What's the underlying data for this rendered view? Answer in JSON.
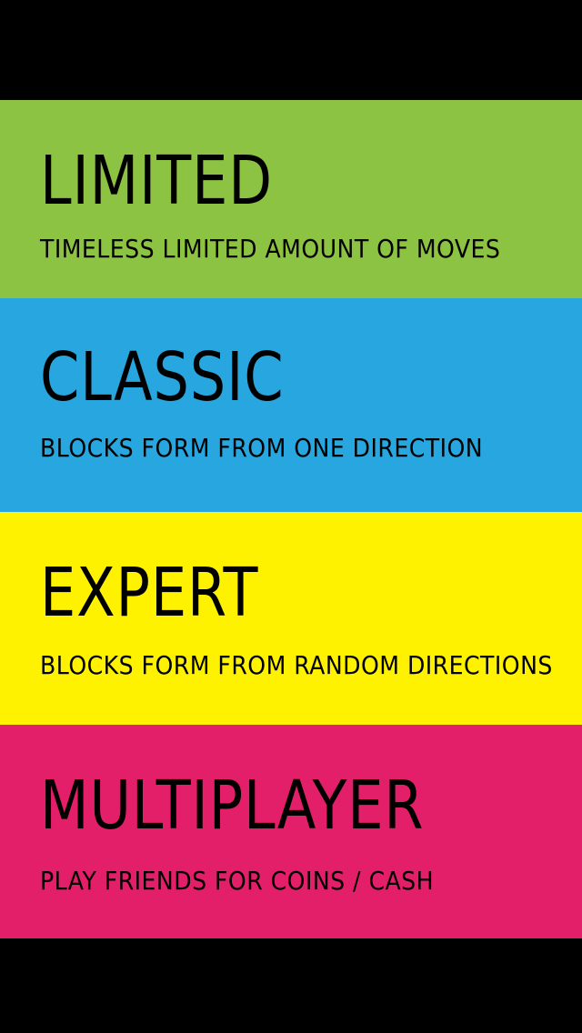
{
  "colors": {
    "background": "#000000",
    "limited": "#8CC342",
    "classic": "#27A6DF",
    "expert": "#FFF200",
    "multiplayer": "#E21F68",
    "text": "#000000"
  },
  "modes": [
    {
      "title": "LIMITED",
      "subtitle": "TIMELESS LIMITED AMOUNT OF MOVES"
    },
    {
      "title": "CLASSIC",
      "subtitle": "BLOCKS FORM FROM ONE DIRECTION"
    },
    {
      "title": "EXPERT",
      "subtitle": "BLOCKS FORM FROM RANDOM DIRECTIONS"
    },
    {
      "title": "MULTIPLAYER",
      "subtitle": "PLAY FRIENDS FOR COINS / CASH"
    }
  ]
}
